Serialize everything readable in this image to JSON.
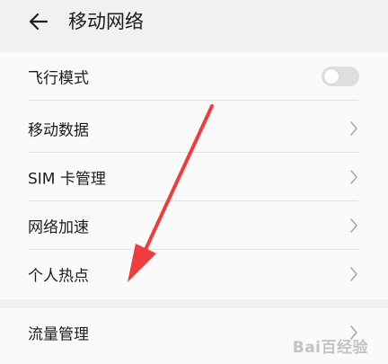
{
  "header": {
    "title": "移动网络",
    "back_icon": "back-arrow-icon"
  },
  "settings": [
    {
      "id": "airplane-mode",
      "label": "飞行模式",
      "control": "toggle",
      "toggle_on": false
    },
    {
      "id": "mobile-data",
      "label": "移动数据",
      "control": "chevron"
    },
    {
      "id": "sim-management",
      "label": "SIM 卡管理",
      "control": "chevron"
    },
    {
      "id": "network-boost",
      "label": "网络加速",
      "control": "chevron"
    },
    {
      "id": "personal-hotspot",
      "label": "个人热点",
      "control": "chevron"
    }
  ],
  "settings_second": [
    {
      "id": "data-usage",
      "label": "流量管理",
      "control": "chevron"
    }
  ],
  "annotation": {
    "arrow_color": "#f03c3c",
    "arrow_target": "personal-hotspot"
  },
  "watermark": {
    "text": "Bai百经验"
  },
  "colors": {
    "background": "#f1f1f1",
    "card": "#fafafa",
    "toggle_off": "#dedede"
  }
}
